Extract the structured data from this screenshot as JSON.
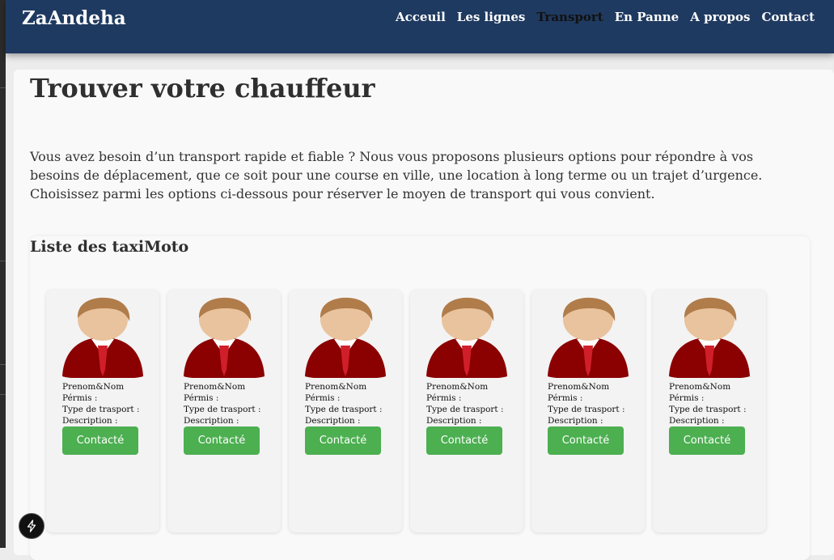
{
  "brand": "ZaAndeha",
  "nav": [
    {
      "label": "Acceuil",
      "active": false
    },
    {
      "label": "Les lignes",
      "active": false
    },
    {
      "label": "Transport",
      "active": true
    },
    {
      "label": "En Panne",
      "active": false
    },
    {
      "label": "A propos",
      "active": false
    },
    {
      "label": "Contact",
      "active": false
    }
  ],
  "page": {
    "title": "Trouver votre chauffeur",
    "intro": "Vous avez besoin d’un transport rapide et fiable ? Nous vous proposons plusieurs options pour répondre à vos besoins de déplacement, que ce soit pour une course en ville, une location à long terme ou un trajet d’urgence. Choisissez parmi les options ci-dessous pour réserver le moyen de transport qui vous convient."
  },
  "section": {
    "title": "Liste des taxiMoto",
    "cards": [
      {
        "name": "Prenom&Nom",
        "permis": "Pérmis :",
        "type": "Type de trasport :",
        "description": "Description :",
        "button": "Contacté"
      },
      {
        "name": "Prenom&Nom",
        "permis": "Pérmis :",
        "type": "Type de trasport :",
        "description": "Description :",
        "button": "Contacté"
      },
      {
        "name": "Prenom&Nom",
        "permis": "Pérmis :",
        "type": "Type de trasport :",
        "description": "Description :",
        "button": "Contacté"
      },
      {
        "name": "Prenom&Nom",
        "permis": "Pérmis :",
        "type": "Type de trasport :",
        "description": "Description :",
        "button": "Contacté"
      },
      {
        "name": "Prenom&Nom",
        "permis": "Pérmis :",
        "type": "Type de trasport :",
        "description": "Description :",
        "button": "Contacté"
      },
      {
        "name": "Prenom&Nom",
        "permis": "Pérmis :",
        "type": "Type de trasport :",
        "description": "Description :",
        "button": "Contacté"
      }
    ]
  },
  "icons": {
    "avatar": "user-avatar-icon",
    "badge": "nextjs-icon"
  },
  "colors": {
    "navbar": "#1f3a60",
    "button": "#4caf50",
    "suit": "#8b0000",
    "tie": "#d01f2a"
  }
}
